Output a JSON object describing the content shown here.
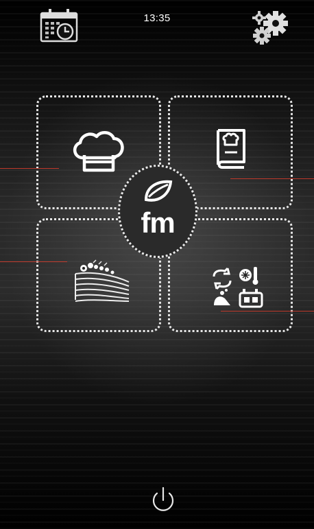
{
  "status": {
    "time": "13:35"
  },
  "icons": {
    "calendar": "calendar-clock-icon",
    "settings": "gears-icon",
    "chef": "chef-hat-icon",
    "recipes": "recipe-book-icon",
    "pastry": "cake-icon",
    "functions": "special-functions-icon",
    "power": "power-icon"
  },
  "logo": {
    "text": "fm"
  },
  "colors": {
    "callout": "#c0392b",
    "tile_border": "#e8e8e8"
  }
}
